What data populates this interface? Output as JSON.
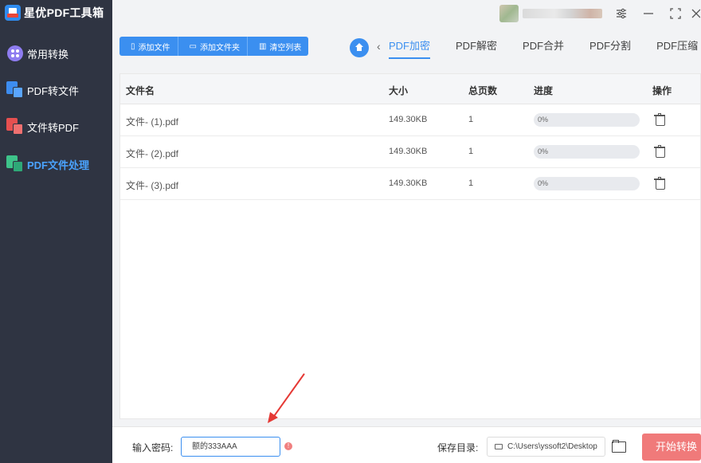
{
  "app": {
    "title": "星优PDF工具箱"
  },
  "sidebar": {
    "items": [
      {
        "label": "常用转换"
      },
      {
        "label": "PDF转文件"
      },
      {
        "label": "文件转PDF"
      },
      {
        "label": "PDF文件处理"
      }
    ]
  },
  "window_controls": {
    "settings": "⚙",
    "minimize": "—",
    "maximize": "⛶",
    "close": "×"
  },
  "toolbar": {
    "add_file": "添加文件",
    "add_folder": "添加文件夹",
    "clear_list": "清空列表"
  },
  "tabs": [
    {
      "label": "PDF加密",
      "active": true
    },
    {
      "label": "PDF解密"
    },
    {
      "label": "PDF合并"
    },
    {
      "label": "PDF分割"
    },
    {
      "label": "PDF压缩"
    }
  ],
  "table": {
    "headers": {
      "name": "文件名",
      "size": "大小",
      "pages": "总页数",
      "progress": "进度",
      "action": "操作"
    },
    "rows": [
      {
        "name": "文件- (1).pdf",
        "size": "149.30KB",
        "pages": "1",
        "progress": "0%"
      },
      {
        "name": "文件- (2).pdf",
        "size": "149.30KB",
        "pages": "1",
        "progress": "0%"
      },
      {
        "name": "文件- (3).pdf",
        "size": "149.30KB",
        "pages": "1",
        "progress": "0%"
      }
    ]
  },
  "bottom": {
    "password_label": "输入密码:",
    "password_value": "额的333AAA",
    "save_label": "保存目录:",
    "save_path": "C:\\Users\\yssoft2\\Desktop",
    "start_button": "开始转换"
  },
  "colors": {
    "accent": "#3b8ff0",
    "sidebar": "#2f3442",
    "start": "#f07a7a",
    "annotation": "#e53935"
  }
}
